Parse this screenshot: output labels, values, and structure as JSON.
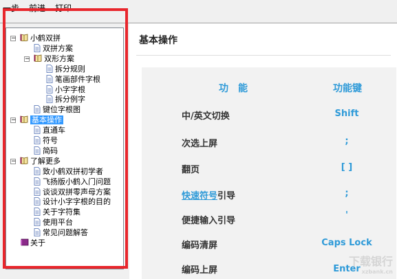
{
  "menubar": {
    "items": [
      "一步",
      "前进",
      "打印"
    ]
  },
  "tree": {
    "nodes": [
      {
        "label": "小鹤双拼",
        "icon": "book",
        "indent": 0,
        "toggle": "−"
      },
      {
        "label": "双拼方案",
        "icon": "page",
        "indent": 1
      },
      {
        "label": "双形方案",
        "icon": "book",
        "indent": 1,
        "toggle": "−"
      },
      {
        "label": "拆分规则",
        "icon": "page",
        "indent": 2
      },
      {
        "label": "笔画部件字根",
        "icon": "page",
        "indent": 2
      },
      {
        "label": "小字字根",
        "icon": "page",
        "indent": 2
      },
      {
        "label": "拆分例字",
        "icon": "page",
        "indent": 2
      },
      {
        "label": "键位字根图",
        "icon": "page",
        "indent": 1
      },
      {
        "label": "基本操作",
        "icon": "book",
        "indent": 0,
        "toggle": "−",
        "selected": true
      },
      {
        "label": "直通车",
        "icon": "page",
        "indent": 1
      },
      {
        "label": "符号",
        "icon": "page",
        "indent": 1
      },
      {
        "label": "简码",
        "icon": "page",
        "indent": 1
      },
      {
        "label": "了解更多",
        "icon": "book",
        "indent": 0,
        "toggle": "−"
      },
      {
        "label": "致小鹤双拼初学者",
        "icon": "page",
        "indent": 1
      },
      {
        "label": "飞扬版小鹤入门问题",
        "icon": "page",
        "indent": 1
      },
      {
        "label": "谈谈双拼零声母方案",
        "icon": "page",
        "indent": 1
      },
      {
        "label": "设计小字字根的目的",
        "icon": "page",
        "indent": 1
      },
      {
        "label": "关于字符集",
        "icon": "page",
        "indent": 1
      },
      {
        "label": "使用平台",
        "icon": "page",
        "indent": 1
      },
      {
        "label": "常见问题解答",
        "icon": "page",
        "indent": 1
      },
      {
        "label": "关于",
        "icon": "book-closed",
        "indent": 0
      }
    ]
  },
  "content": {
    "title": "基本操作",
    "header": {
      "function": "功　能",
      "key": "功能键"
    },
    "rows": [
      {
        "label": "中/英文切换",
        "key": "Shift"
      },
      {
        "label": "次选上屏",
        "key": ";"
      },
      {
        "label": "翻页",
        "key": "[ ]"
      },
      {
        "label_link": "快速符号",
        "label_rest": "引导",
        "key": ";"
      },
      {
        "label": "便捷输入引导",
        "key": "'"
      },
      {
        "label": "编码清屏",
        "key": "Caps Lock"
      },
      {
        "label": "编码上屏",
        "key": "Enter"
      }
    ]
  },
  "watermark": {
    "main": "下载银行",
    "sub": "xzbank.cn"
  },
  "colors": {
    "accent": "#2e9ad8",
    "highlight": "#e8262c",
    "selection": "#3399ff"
  }
}
